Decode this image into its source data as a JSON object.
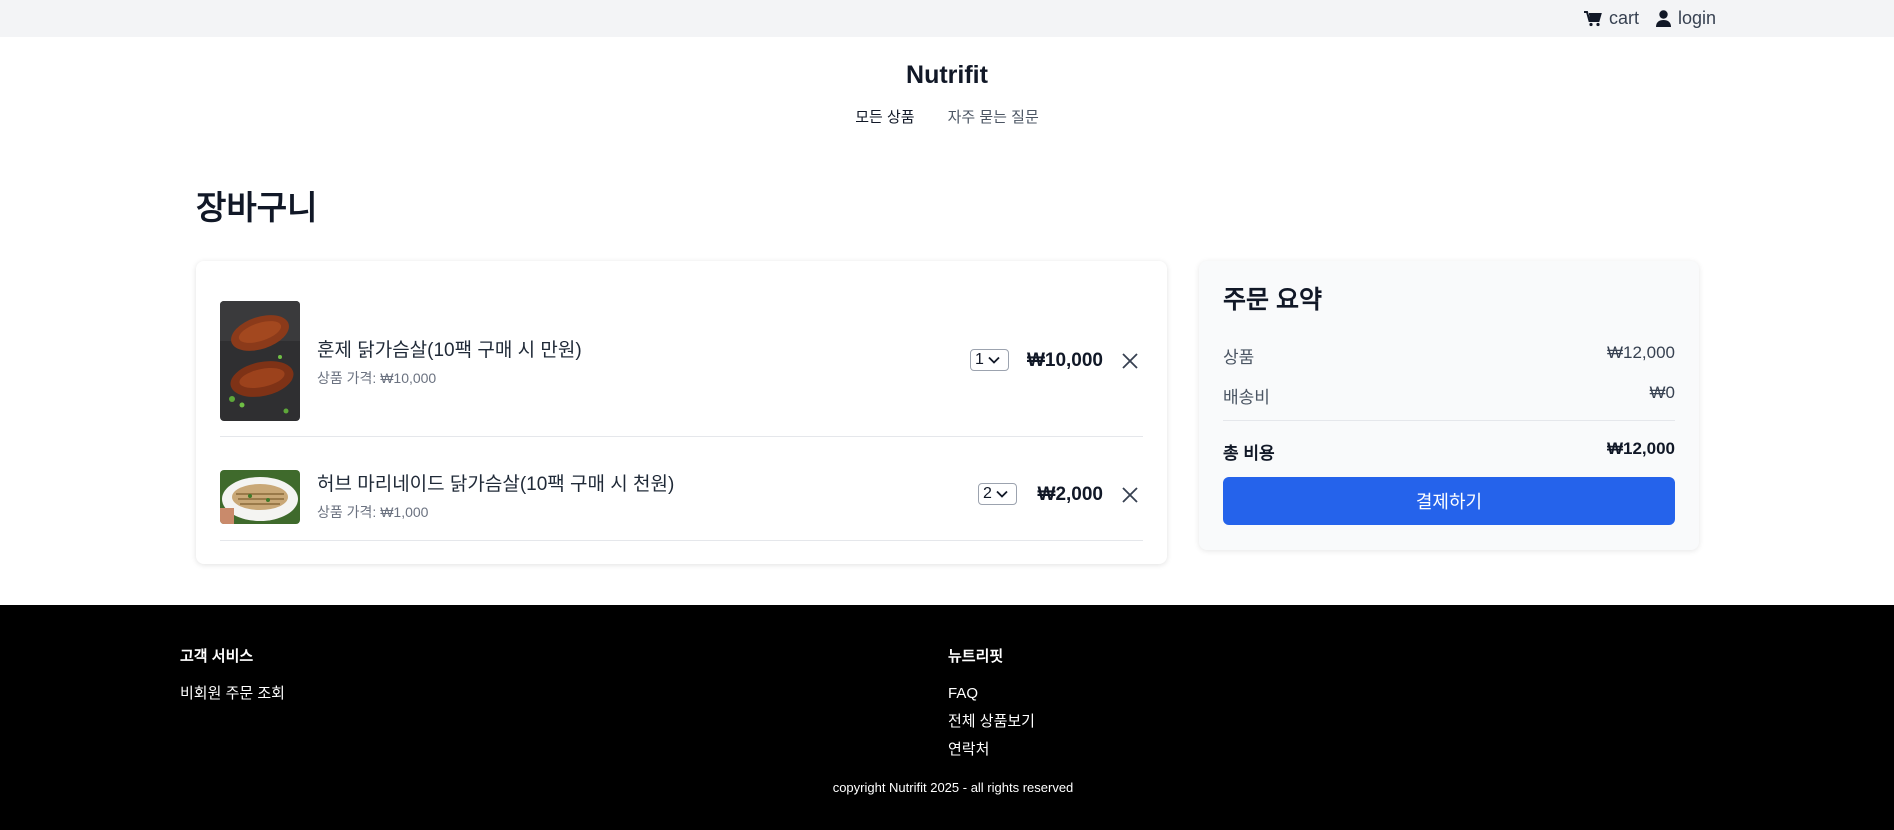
{
  "topbar": {
    "cart_label": "cart",
    "login_label": "login"
  },
  "header": {
    "brand": "Nutrifit",
    "nav": [
      "모든 상품",
      "자주 묻는 질문"
    ]
  },
  "page": {
    "title": "장바구니"
  },
  "cart": {
    "items": [
      {
        "name": "훈제 닭가슴살(10팩 구매 시 만원)",
        "price_line": "상품 가격: ₩10,000",
        "quantity": "1",
        "subtotal": "₩10,000"
      },
      {
        "name": "허브 마리네이드 닭가슴살(10팩 구매 시 천원)",
        "price_line": "상품 가격: ₩1,000",
        "quantity": "2",
        "subtotal": "₩2,000"
      }
    ]
  },
  "summary": {
    "title": "주문 요약",
    "products_label": "상품",
    "products_value": "₩12,000",
    "shipping_label": "배송비",
    "shipping_value": "₩0",
    "total_label": "총 비용",
    "total_value": "₩12,000",
    "checkout_label": "결제하기"
  },
  "footer": {
    "col1_title": "고객 서비스",
    "col1_links": [
      "비회원 주문 조회"
    ],
    "col2_title": "뉴트리핏",
    "col2_links": [
      "FAQ",
      "전체 상품보기",
      "연락처"
    ],
    "copyright": "copyright Nutrifit 2025 - all rights reserved"
  },
  "colors": {
    "accent": "#2563eb",
    "topbar_bg": "#f3f4f6",
    "footer_bg": "#000000"
  },
  "icons": [
    "cart-icon",
    "user-icon",
    "chevron-down-icon",
    "close-icon"
  ]
}
